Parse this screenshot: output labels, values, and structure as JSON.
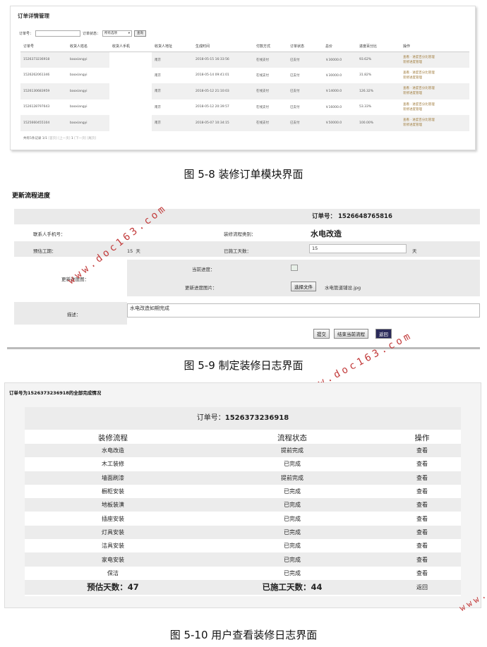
{
  "fig1": {
    "title": "订单详情管理",
    "search": {
      "order_label": "订单号：",
      "status_label": "订单状态：",
      "status_value": "所有选项",
      "query_button": "查询"
    },
    "columns": [
      "订单号",
      "收货人姓名",
      "收货人手机",
      "收货人地址",
      "生成时间",
      "付款方式",
      "订单状态",
      "总价",
      "进度百分比",
      "操作"
    ],
    "rows": [
      {
        "order": "1526373236918",
        "name": "baoxiangyi",
        "phone": "",
        "addr": "南京",
        "time": "2018-05-15 16:33:56",
        "pay": "在线支付",
        "status": "已支付",
        "price": "￥30000.0",
        "pct": "93.62%",
        "op1": "查看 · 进度百分比管理",
        "op2": "装修进度管理"
      },
      {
        "order": "1526262061346",
        "name": "baoxiangyi",
        "phone": "",
        "addr": "南京",
        "time": "2018-05-14 09:41:01",
        "pay": "在线支付",
        "status": "已支付",
        "price": "￥30000.0",
        "pct": "31.82%",
        "op1": "查看 · 进度百分比管理",
        "op2": "装修进度管理"
      },
      {
        "order": "1526130683959",
        "name": "baoxiangyi",
        "phone": "",
        "addr": "南京",
        "time": "2018-05-12 21:10:03",
        "pay": "在线支付",
        "status": "已支付",
        "price": "￥14000.0",
        "pct": "126.32%",
        "op1": "查看 · 进度百分比管理",
        "op2": "装修进度管理"
      },
      {
        "order": "1526128797643",
        "name": "baoxiangyi",
        "phone": "",
        "addr": "南京",
        "time": "2018-05-12 20:39:57",
        "pay": "在线支付",
        "status": "已支付",
        "price": "￥16000.0",
        "pct": "53.33%",
        "op1": "查看 · 进度百分比管理",
        "op2": "装修进度管理"
      },
      {
        "order": "1525660455104",
        "name": "baoxiangyi",
        "phone": "",
        "addr": "南京",
        "time": "2018-05-07 10:34:15",
        "pay": "在线支付",
        "status": "已支付",
        "price": "￥50000.0",
        "pct": "100.00%",
        "op1": "查看 · 进度百分比管理",
        "op2": "装修进度管理"
      }
    ],
    "pager": {
      "summary": "共有5条记录 1/1",
      "first": "[首页]",
      "prev": "[上一页]",
      "current": "1",
      "next": "[下一页]",
      "last": "[尾页]"
    }
  },
  "caption1": "图 5-8 装修订单模块界面",
  "fig2": {
    "title": "更新流程进度",
    "order_label": "订单号：",
    "order_no": "1526648765816",
    "contact_label": "联系人手机号：",
    "category_label": "装修流程类别：",
    "category_value": "水电改造",
    "estimate_label": "预估工期：",
    "estimate_value": "15",
    "estimate_unit": "天",
    "worked_label": "已施工天数：",
    "worked_value": "15",
    "worked_unit": "天",
    "progress_img_label": "更新进度图：",
    "current_progress_label": "当前进度：",
    "new_img_label": "更新进度图片：",
    "file_button": "选择文件",
    "file_name": "水电管道铺设.jpg",
    "desc_label": "描述：",
    "desc_value": "水电改造如期完成",
    "submit_button": "提交",
    "finish_button": "结束当前流程",
    "back_button": "返回",
    "watermark": "www.doc163.com"
  },
  "caption2": "图 5-9 制定装修日志界面",
  "fig3": {
    "title": "订单号为1526373236918的全部完成情况",
    "order_label": "订单号：",
    "order_no": "1526373236918",
    "columns": [
      "装修流程",
      "流程状态",
      "操作"
    ],
    "rows": [
      {
        "step": "水电改造",
        "state": "提前完成",
        "op": "查看"
      },
      {
        "step": "木工装修",
        "state": "已完成",
        "op": "查看"
      },
      {
        "step": "墙面刷漆",
        "state": "提前完成",
        "op": "查看"
      },
      {
        "step": "橱柜安装",
        "state": "已完成",
        "op": "查看"
      },
      {
        "step": "地板装潢",
        "state": "已完成",
        "op": "查看"
      },
      {
        "step": "插座安装",
        "state": "已完成",
        "op": "查看"
      },
      {
        "step": "灯具安装",
        "state": "已完成",
        "op": "查看"
      },
      {
        "step": "洁具安装",
        "state": "已完成",
        "op": "查看"
      },
      {
        "step": "家电安装",
        "state": "已完成",
        "op": "查看"
      },
      {
        "step": "保洁",
        "state": "已完成",
        "op": "查看"
      }
    ],
    "estimate_text": "预估天数：47",
    "worked_text": "已施工天数：44",
    "back_button": "返回"
  },
  "caption3": "图 5-10 用户查看装修日志界面"
}
